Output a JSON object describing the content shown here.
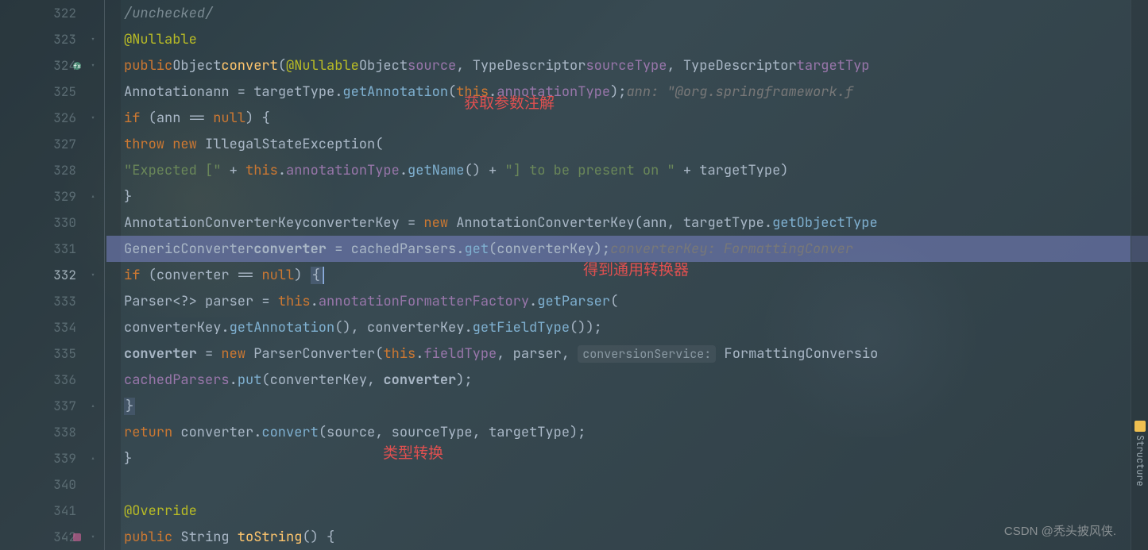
{
  "gutter": {
    "lines": [
      "322",
      "323",
      "324",
      "325",
      "326",
      "327",
      "328",
      "329",
      "330",
      "331",
      "332",
      "333",
      "334",
      "335",
      "336",
      "337",
      "338",
      "339",
      "340",
      "341",
      "342"
    ],
    "active": "332"
  },
  "code": {
    "l322": {
      "comment": "/unchecked/"
    },
    "l323": {
      "annotation": "@Nullable"
    },
    "l324": {
      "kw1": "public",
      "type1": "Object",
      "method": "convert",
      "paren": "(",
      "ann": "@Nullable",
      "type2": "Object",
      "p1": "source",
      "c1": ", ",
      "type3": "TypeDescriptor",
      "p2": "sourceType",
      "c2": ", ",
      "type4": "TypeDescriptor",
      "p3": "targetTyp"
    },
    "l325": {
      "type": "Annotation",
      "var": "ann",
      "eq": " = ",
      "obj": "targetType",
      "dot": ".",
      "m": "getAnnotation",
      "open": "(",
      "kw": "this",
      "dot2": ".",
      "f": "annotationType",
      "close": ");",
      "hint": "ann: \"@org.springframework.f"
    },
    "l326": {
      "kw": "if",
      "open": " (",
      "var": "ann",
      "op": " == ",
      "nul": "null",
      "close": ") {"
    },
    "l327": {
      "kw": "throw",
      "kw2": " new",
      "type": " IllegalStateException",
      "open": "("
    },
    "l328": {
      "s1": "\"Expected [\"",
      "op1": " + ",
      "kw": "this",
      "dot": ".",
      "f": "annotationType",
      "dot2": ".",
      "m": "getName",
      "call": "()",
      "op2": " + ",
      "s2": "\"] to be present on \"",
      "op3": " + ",
      "var": "targetType)"
    },
    "l329": {
      "brace": "}"
    },
    "l330": {
      "type": "AnnotationConverterKey",
      "var": "converterKey",
      "eq": " = ",
      "kw": "new",
      "type2": " AnnotationConverterKey",
      "open": "(",
      "p1": "ann",
      "c1": ", ",
      "obj": "targetType",
      "dot": ".",
      "m": "getObjectType"
    },
    "l331": {
      "type": "GenericConverter",
      "var": "converter",
      "eq": " = ",
      "obj": "cachedParsers",
      "dot": ".",
      "m": "get",
      "open": "(",
      "p": "converterKey",
      "close": ");",
      "hint": "converterKey: FormattingConver"
    },
    "l332": {
      "kw": "if",
      "open": " (",
      "var": "converter",
      "op": " == ",
      "nul": "null",
      "close": ") ",
      "brace": "{"
    },
    "l333": {
      "type": "Parser",
      "gen": "<?>",
      "var": " parser",
      "eq": " = ",
      "kw": "this",
      "dot": ".",
      "f": "annotationFormatterFactory",
      "dot2": ".",
      "m": "getParser",
      "open": "("
    },
    "l334": {
      "obj": "converterKey",
      "dot": ".",
      "m1": "getAnnotation",
      "call1": "()",
      "c1": ", ",
      "obj2": "converterKey",
      "dot2": ".",
      "m2": "getFieldType",
      "call2": "());"
    },
    "l335": {
      "var": "converter",
      "eq": " = ",
      "kw": "new",
      "type": " ParserConverter",
      "open": "(",
      "kw2": "this",
      "dot": ".",
      "f": "fieldType",
      "c1": ", ",
      "p2": "parser",
      "c2": ", ",
      "hint": "conversionService:",
      "p3": " FormattingConversio"
    },
    "l336": {
      "obj": "cachedParsers",
      "dot": ".",
      "m": "put",
      "open": "(",
      "p1": "converterKey",
      "c1": ", ",
      "p2": "converter",
      "close": ");"
    },
    "l337": {
      "brace": "}"
    },
    "l338": {
      "kw": "return",
      "var": " converter",
      "dot": ".",
      "m": "convert",
      "open": "(",
      "p1": "source",
      "c1": ", ",
      "p2": "sourceType",
      "c2": ", ",
      "p3": "targetType",
      "close": ");"
    },
    "l339": {
      "brace": "}"
    },
    "l341": {
      "annotation": "@Override"
    },
    "l342": {
      "kw1": "public",
      "type": " String",
      "m": " toString",
      "open": "() {"
    }
  },
  "annotations": {
    "a1": "获取参数注解",
    "a2": "得到通用转换器",
    "a3": "类型转换"
  },
  "rightPanel": {
    "structure": "Structure"
  },
  "watermark": "CSDN @秃头披风侠."
}
